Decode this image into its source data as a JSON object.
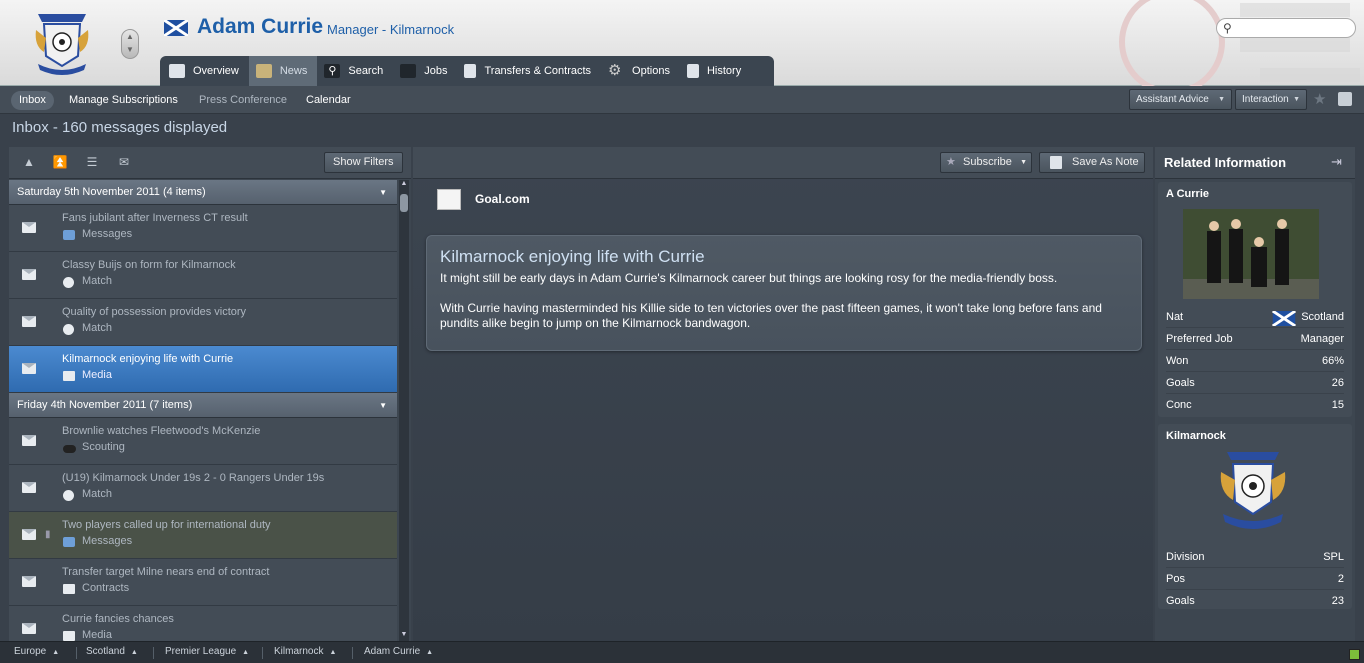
{
  "header": {
    "manager_name": "Adam Currie",
    "manager_role": "Manager - Kilmarnock",
    "search_placeholder": ""
  },
  "tabs": [
    {
      "label": "Overview",
      "icon": "overview-icon"
    },
    {
      "label": "News",
      "icon": "news-icon",
      "active": true
    },
    {
      "label": "Search",
      "icon": "search-icon"
    },
    {
      "label": "Jobs",
      "icon": "briefcase-icon"
    },
    {
      "label": "Transfers & Contracts",
      "icon": "contract-icon"
    },
    {
      "label": "Options",
      "icon": "gear-icon"
    },
    {
      "label": "History",
      "icon": "history-icon"
    }
  ],
  "subnav": {
    "inbox": "Inbox",
    "manage": "Manage Subscriptions",
    "press": "Press Conference",
    "calendar": "Calendar",
    "assistant": "Assistant Advice",
    "interaction": "Interaction"
  },
  "page_title": "Inbox - 160 messages displayed",
  "left_toolbar": {
    "show_filters": "Show Filters"
  },
  "groups": [
    {
      "label": "Saturday 5th November 2011 (4 items)",
      "messages": [
        {
          "title": "Fans jubilant after Inverness CT result",
          "category": "Messages"
        },
        {
          "title": "Classy Buijs on form for Kilmarnock",
          "category": "Match"
        },
        {
          "title": "Quality of possession provides victory",
          "category": "Match"
        },
        {
          "title": "Kilmarnock enjoying life with Currie",
          "category": "Media",
          "selected": true
        }
      ]
    },
    {
      "label": "Friday 4th November 2011 (7 items)",
      "messages": [
        {
          "title": "Brownlie watches Fleetwood's McKenzie",
          "category": "Scouting"
        },
        {
          "title": "(U19) Kilmarnock Under 19s 2 - 0 Rangers Under 19s",
          "category": "Match"
        },
        {
          "title": "Two players called up for international duty",
          "category": "Messages"
        },
        {
          "title": "Transfer target Milne nears end of contract",
          "category": "Contracts"
        },
        {
          "title": "Currie fancies chances",
          "category": "Media"
        }
      ]
    }
  ],
  "center": {
    "subscribe": "Subscribe",
    "save_note": "Save As Note",
    "source": "Goal.com",
    "headline": "Kilmarnock enjoying life with Currie",
    "para1": "It might still be early days in Adam Currie's Kilmarnock career but things are looking rosy for the media-friendly boss.",
    "para2": "With Currie having masterminded his Killie side to ten victories over the past fifteen games, it won't take long before fans and pundits alike begin to jump on the Kilmarnock bandwagon."
  },
  "related": {
    "title": "Related Information",
    "person": {
      "name": "A Currie",
      "rows": [
        {
          "k": "Nat",
          "v": "Scotland"
        },
        {
          "k": "Preferred Job",
          "v": "Manager"
        },
        {
          "k": "Won",
          "v": "66%"
        },
        {
          "k": "Goals",
          "v": "26"
        },
        {
          "k": "Conc",
          "v": "15"
        }
      ]
    },
    "club": {
      "name": "Kilmarnock",
      "rows": [
        {
          "k": "Division",
          "v": "SPL"
        },
        {
          "k": "Pos",
          "v": "2"
        },
        {
          "k": "Goals",
          "v": "23"
        }
      ]
    }
  },
  "breadcrumb": [
    "Europe",
    "Scotland",
    "Premier League",
    "Kilmarnock",
    "Adam Currie"
  ],
  "colors": {
    "accent": "#1e5fa8",
    "selected": "#3a78c0"
  }
}
